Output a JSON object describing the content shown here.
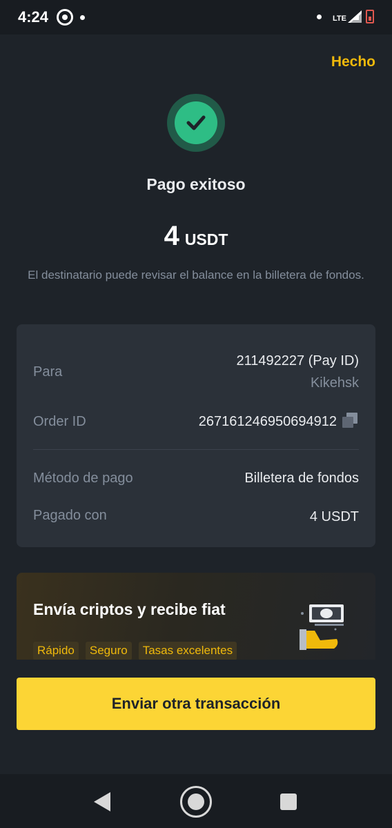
{
  "status_bar": {
    "time": "4:24",
    "network": "LTE",
    "icons": [
      "notification-icon",
      "signal-icon",
      "battery-icon"
    ]
  },
  "header": {
    "done_label": "Hecho"
  },
  "result": {
    "icon": "check-circle-icon",
    "title": "Pago exitoso",
    "amount": "4",
    "currency": "USDT",
    "subtitle": "El destinatario puede revisar el balance en la billetera de fondos."
  },
  "details": {
    "to_label": "Para",
    "to_value": "211492227 (Pay ID)",
    "to_name": "Kikehsk",
    "order_label": "Order ID",
    "order_value": "267161246950694912",
    "method_label": "Método de pago",
    "method_value": "Billetera de fondos",
    "paid_label": "Pagado con",
    "paid_value": "4 USDT"
  },
  "promo": {
    "title": "Envía criptos y recibe fiat",
    "tags": [
      "Rápido",
      "Seguro",
      "Tasas excelentes"
    ]
  },
  "actions": {
    "primary_label": "Enviar otra transacción"
  },
  "colors": {
    "background": "#1e2329",
    "card": "#2b3139",
    "accent": "#f0b90b",
    "button": "#fcd535",
    "success": "#2ebd85",
    "muted": "#848e9c"
  }
}
